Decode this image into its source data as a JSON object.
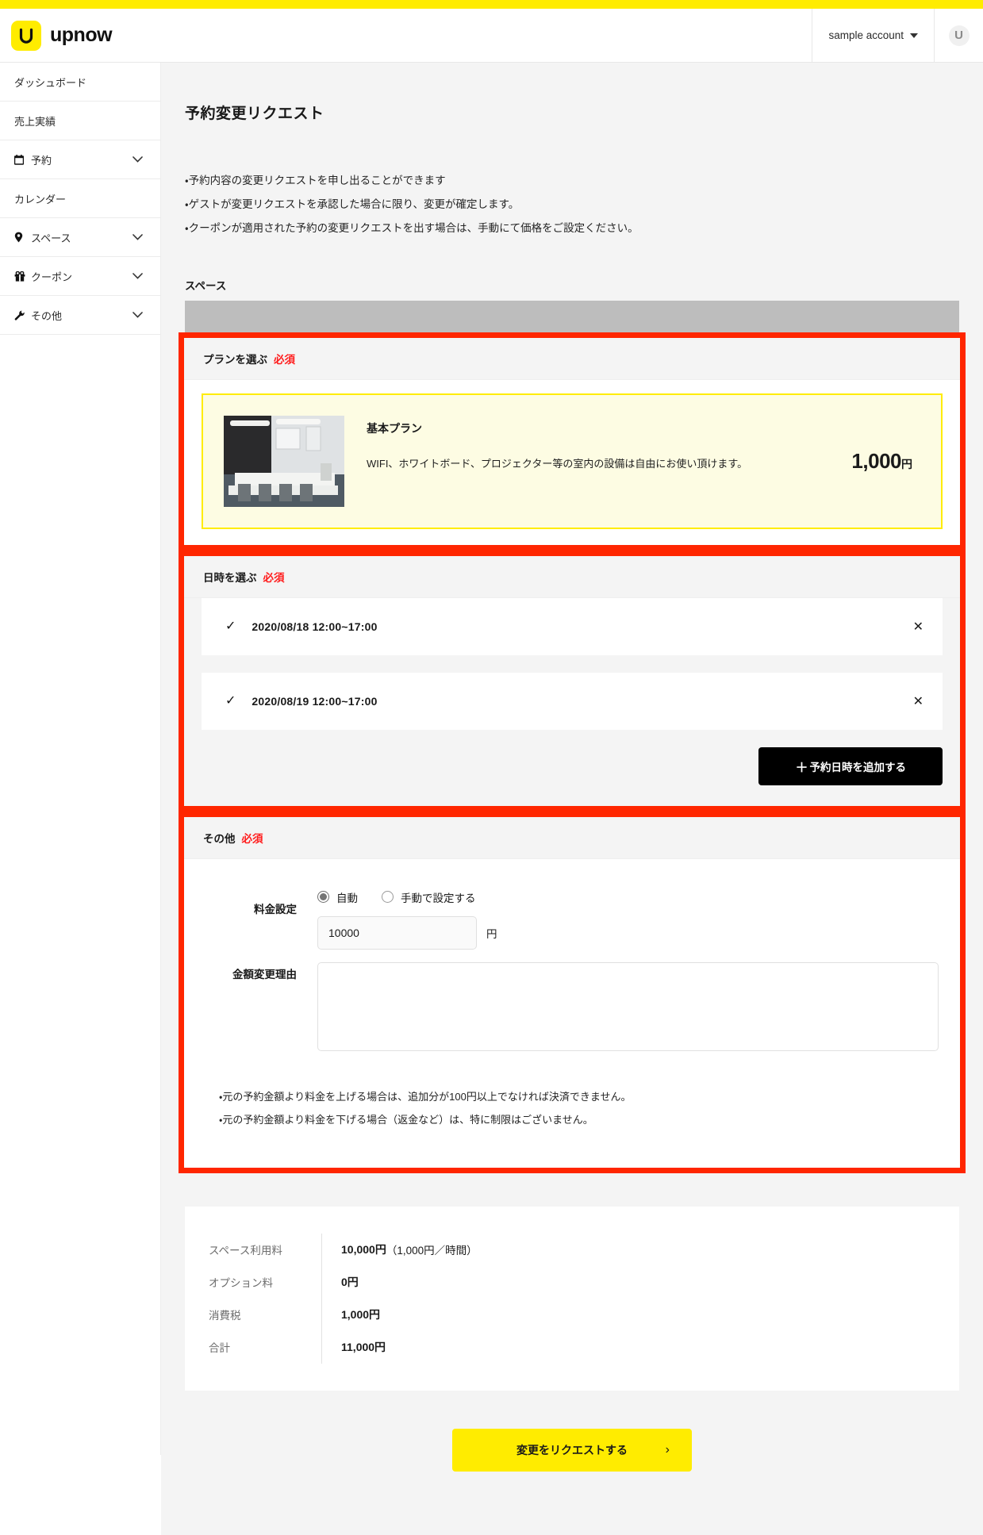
{
  "brand": {
    "name": "upnow",
    "mark_letter": "u",
    "accent": "#ffec00"
  },
  "header": {
    "account_label": "sample account",
    "avatar_letter": "U"
  },
  "sidebar": {
    "items": [
      {
        "label": "ダッシュボード",
        "icon": "",
        "chevron": false
      },
      {
        "label": "売上実績",
        "icon": "",
        "chevron": false
      },
      {
        "label": "予約",
        "icon": "calendar-icon",
        "chevron": true
      },
      {
        "label": "カレンダー",
        "icon": "",
        "chevron": false
      },
      {
        "label": "スペース",
        "icon": "pin-icon",
        "chevron": true
      },
      {
        "label": "クーポン",
        "icon": "gift-icon",
        "chevron": true
      },
      {
        "label": "その他",
        "icon": "wrench-icon",
        "chevron": true
      }
    ]
  },
  "main": {
    "page_title": "予約変更リクエスト",
    "notes": [
      "・予約内容の変更リクエストを申し出ることができます",
      "・ゲストが変更リクエストを承認した場合に限り、変更が確定します。",
      "・クーポンが適用された予約の変更リクエストを出す場合は、手動にて価格をご設定ください。"
    ],
    "space_label": "スペース",
    "plan_section": {
      "heading": "プランを選ぶ",
      "required": "必須",
      "plan": {
        "name": "基本プラン",
        "description": "WIFI、ホワイトボード、プロジェクター等の室内の設備は自由にお使い頂けます。",
        "price_number": "1,000",
        "price_unit": "円"
      }
    },
    "datetime_section": {
      "heading": "日時を選ぶ",
      "required": "必須",
      "rows": [
        {
          "check": "✓",
          "text": "2020/08/18 12:00~17:00",
          "remove": "✕"
        },
        {
          "check": "✓",
          "text": "2020/08/19 12:00~17:00",
          "remove": "✕"
        }
      ],
      "add_button": {
        "plus": "＋",
        "label": "予約日時を追加する"
      }
    },
    "other_section": {
      "heading": "その他",
      "required": "必須",
      "price_setting": {
        "label": "料金設定",
        "options": [
          {
            "label": "自動",
            "selected": true
          },
          {
            "label": "手動で設定する",
            "selected": false
          }
        ],
        "amount_value": "10000",
        "amount_placeholder": "",
        "unit": "円"
      },
      "reason": {
        "label": "金額変更理由",
        "value": "",
        "placeholder": ""
      },
      "notes": [
        "・元の予約金額より料金を上げる場合は、追加分が100円以上でなければ決済できません。",
        "・元の予約金額より料金を下げる場合（返金など）は、特に制限はございません。"
      ]
    },
    "summary": {
      "rows": [
        {
          "key": "スペース利用料",
          "value": "10,000円",
          "suffix": "（1,000円／時間）"
        },
        {
          "key": "オプション料",
          "value": "0円",
          "suffix": ""
        },
        {
          "key": "消費税",
          "value": "1,000円",
          "suffix": ""
        },
        {
          "key": "合計",
          "value": "11,000円",
          "suffix": ""
        }
      ]
    },
    "submit": {
      "label": "変更をリクエストする",
      "arrow": "›"
    }
  }
}
